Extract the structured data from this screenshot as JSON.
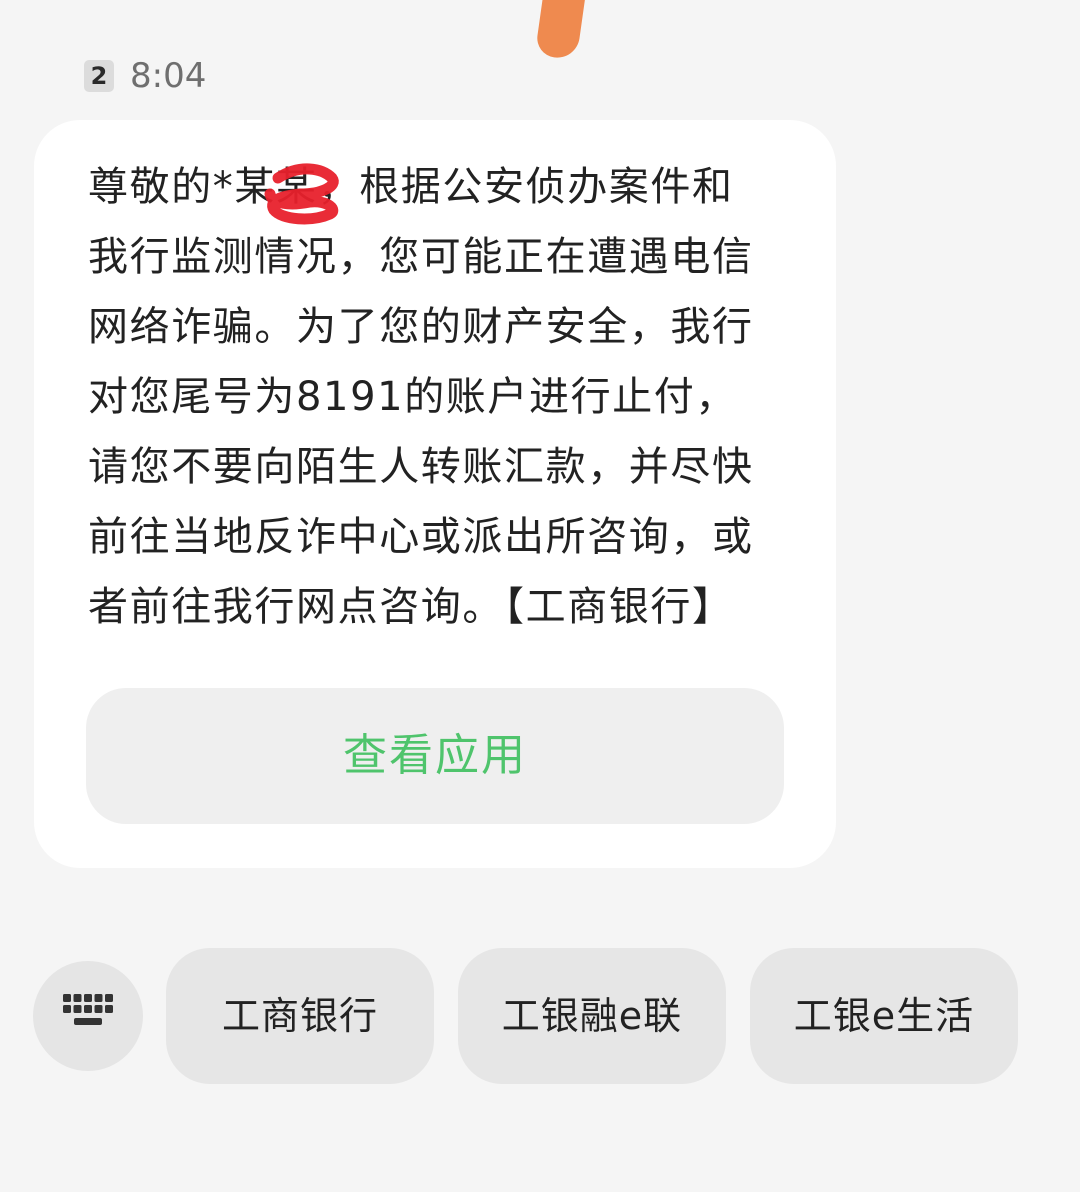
{
  "conversation": {
    "sim_slot": "2",
    "time": "8:04"
  },
  "message": {
    "text": "尊敬的*某某，根据公安侦办案件和\n我行监测情况，您可能正在遭遇电信\n网络诈骗。为了您的财产安全，我行\n对您尾号为8191的账户进行止付，\n请您不要向陌生人转账汇款，并尽快\n前往当地反诈中心或派出所咨询，或\n者前往我行网点咨询。【工商银行】",
    "action_button_label": "查看应用"
  },
  "quick_replies": [
    {
      "label": "工商银行"
    },
    {
      "label": "工银融e联"
    },
    {
      "label": "工银e生活"
    }
  ],
  "keyboard_toggle": {
    "icon": "keyboard-icon"
  },
  "colors": {
    "accent_green": "#4fc46c",
    "bubble_background": "#ffffff",
    "page_background": "#f5f5f5",
    "redaction_scribble": "#e8212c",
    "orange_shape": "#ef8a4f"
  }
}
